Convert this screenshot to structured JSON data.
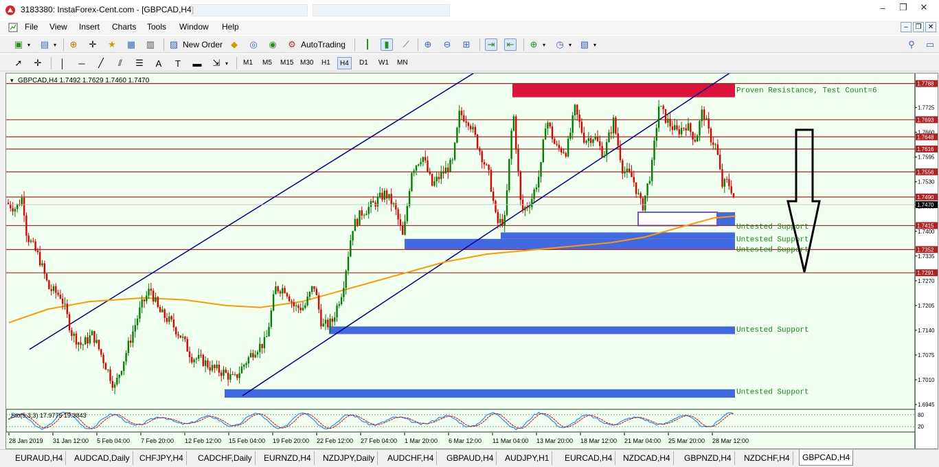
{
  "window": {
    "title": "3183380: InstaForex-Cent.com - [GBPCAD,H4]",
    "controls": [
      "–",
      "❐",
      "✕"
    ]
  },
  "menu": [
    "File",
    "View",
    "Insert",
    "Charts",
    "Tools",
    "Window",
    "Help"
  ],
  "toolbar": {
    "new_order": "New Order",
    "autotrading": "AutoTrading"
  },
  "timeframes": [
    "M1",
    "M5",
    "M15",
    "M30",
    "H1",
    "H4",
    "D1",
    "W1",
    "MN"
  ],
  "active_timeframe": "H4",
  "chart": {
    "header": "GBPCAD,H4  1.7492 1.7629 1.7460 1.7470",
    "current_price": "1.7470",
    "oscillator_label": "Sto(5,3,3) 17.9775 19.3843",
    "osc_levels": [
      "80",
      "20"
    ],
    "annotations": [
      {
        "text": "Proven Resistance, Test Count=6",
        "price": 1.777
      },
      {
        "text": "Untested Support",
        "price": 1.7412
      },
      {
        "text": "Untested Support",
        "price": 1.7379
      },
      {
        "text": "Untested Support",
        "price": 1.7352
      },
      {
        "text": "Untested Support",
        "price": 1.7142
      },
      {
        "text": "Untested Support",
        "price": 1.6978
      }
    ],
    "colors": {
      "bull": "#008000",
      "bear": "#e00000",
      "channel": "#00008b",
      "ma": "#ff9900",
      "resistance_zone": "#dc143c",
      "support_zone": "#4169e1",
      "hline": "#b22222",
      "annotation": "#1a8a1a",
      "stoch_main": "#1e90ff",
      "stoch_signal": "#e00000"
    }
  },
  "chart_data": {
    "type": "candlestick",
    "symbol": "GBPCAD",
    "timeframe": "H4",
    "y_ticks": [
      "1.7725",
      "1.7660",
      "1.7595",
      "1.7530",
      "1.7465",
      "1.7400",
      "1.7335",
      "1.7270",
      "1.7205",
      "1.7140",
      "1.7075",
      "1.7010",
      "1.6945"
    ],
    "ylim": [
      1.6936,
      1.78
    ],
    "price_labels": [
      {
        "text": "1.7788",
        "price": 1.7788
      },
      {
        "text": "1.7693",
        "price": 1.7693
      },
      {
        "text": "1.7648",
        "price": 1.7648
      },
      {
        "text": "1.7616",
        "price": 1.7616
      },
      {
        "text": "1.7556",
        "price": 1.7556
      },
      {
        "text": "1.7490",
        "price": 1.749
      },
      {
        "text": "1.7415",
        "price": 1.7415
      },
      {
        "text": "1.7352",
        "price": 1.7352
      },
      {
        "text": "1.7291",
        "price": 1.7291
      }
    ],
    "x_labels": [
      "28 Jan 2019",
      "31 Jan 12:00",
      "5 Feb 04:00",
      "7 Feb 20:00",
      "12 Feb 12:00",
      "15 Feb 04:00",
      "19 Feb 20:00",
      "22 Feb 12:00",
      "27 Feb 04:00",
      "1 Mar 20:00",
      "6 Mar 12:00",
      "11 Mar 04:00",
      "13 Mar 20:00",
      "18 Mar 12:00",
      "21 Mar 04:00",
      "25 Mar 20:00",
      "28 Mar 12:00"
    ],
    "close_path": [
      [
        0,
        1.7475
      ],
      [
        14,
        1.746
      ],
      [
        24,
        1.749
      ],
      [
        30,
        1.739
      ],
      [
        48,
        1.733
      ],
      [
        62,
        1.725
      ],
      [
        80,
        1.723
      ],
      [
        96,
        1.713
      ],
      [
        110,
        1.71
      ],
      [
        126,
        1.713
      ],
      [
        142,
        1.706
      ],
      [
        158,
        1.699
      ],
      [
        176,
        1.709
      ],
      [
        196,
        1.72
      ],
      [
        210,
        1.725
      ],
      [
        222,
        1.719
      ],
      [
        240,
        1.716
      ],
      [
        256,
        1.712
      ],
      [
        270,
        1.707
      ],
      [
        286,
        1.706
      ],
      [
        300,
        1.704
      ],
      [
        316,
        1.703
      ],
      [
        332,
        1.701
      ],
      [
        346,
        1.705
      ],
      [
        362,
        1.709
      ],
      [
        378,
        1.711
      ],
      [
        392,
        1.725
      ],
      [
        406,
        1.725
      ],
      [
        420,
        1.72
      ],
      [
        434,
        1.72
      ],
      [
        448,
        1.726
      ],
      [
        460,
        1.715
      ],
      [
        474,
        1.716
      ],
      [
        490,
        1.725
      ],
      [
        504,
        1.741
      ],
      [
        518,
        1.745
      ],
      [
        534,
        1.747
      ],
      [
        552,
        1.75
      ],
      [
        566,
        1.746
      ],
      [
        578,
        1.738
      ],
      [
        590,
        1.756
      ],
      [
        606,
        1.76
      ],
      [
        620,
        1.752
      ],
      [
        634,
        1.755
      ],
      [
        650,
        1.758
      ],
      [
        660,
        1.771
      ],
      [
        674,
        1.769
      ],
      [
        690,
        1.761
      ],
      [
        704,
        1.754
      ],
      [
        714,
        1.742
      ],
      [
        726,
        1.743
      ],
      [
        738,
        1.772
      ],
      [
        750,
        1.745
      ],
      [
        764,
        1.748
      ],
      [
        778,
        1.756
      ],
      [
        786,
        1.77
      ],
      [
        800,
        1.762
      ],
      [
        816,
        1.761
      ],
      [
        828,
        1.772
      ],
      [
        842,
        1.764
      ],
      [
        856,
        1.765
      ],
      [
        870,
        1.76
      ],
      [
        884,
        1.769
      ],
      [
        898,
        1.756
      ],
      [
        912,
        1.754
      ],
      [
        926,
        1.746
      ],
      [
        940,
        1.757
      ],
      [
        950,
        1.773
      ],
      [
        962,
        1.769
      ],
      [
        976,
        1.766
      ],
      [
        990,
        1.768
      ],
      [
        1004,
        1.764
      ],
      [
        1014,
        1.772
      ],
      [
        1024,
        1.765
      ],
      [
        1034,
        1.762
      ],
      [
        1042,
        1.752
      ],
      [
        1050,
        1.753
      ],
      [
        1056,
        1.751
      ],
      [
        1062,
        1.747
      ]
    ],
    "ma_path": [
      [
        4,
        1.716
      ],
      [
        60,
        1.7195
      ],
      [
        120,
        1.7215
      ],
      [
        200,
        1.7225
      ],
      [
        260,
        1.722
      ],
      [
        320,
        1.7205
      ],
      [
        370,
        1.72
      ],
      [
        430,
        1.7215
      ],
      [
        470,
        1.7235
      ],
      [
        520,
        1.726
      ],
      [
        580,
        1.729
      ],
      [
        640,
        1.732
      ],
      [
        700,
        1.734
      ],
      [
        760,
        1.735
      ],
      [
        820,
        1.736
      ],
      [
        880,
        1.737
      ],
      [
        930,
        1.7385
      ],
      [
        980,
        1.741
      ],
      [
        1030,
        1.7435
      ],
      [
        1062,
        1.744
      ]
    ],
    "hlines": [
      1.7788,
      1.7693,
      1.7648,
      1.7616,
      1.7556,
      1.749,
      1.7415,
      1.7352,
      1.7291
    ],
    "resistance_zone": {
      "x_start": 737,
      "x_end": 1061,
      "high": 1.7788,
      "low": 1.7752
    },
    "support_zones": [
      {
        "x_start": 920,
        "x_end": 1061,
        "high": 1.745,
        "low": 1.7415
      },
      {
        "x_start": 720,
        "x_end": 1061,
        "high": 1.7397,
        "low": 1.738
      },
      {
        "x_start": 580,
        "x_end": 1061,
        "high": 1.738,
        "low": 1.7353
      },
      {
        "x_start": 470,
        "x_end": 1061,
        "high": 1.715,
        "low": 1.713
      },
      {
        "x_start": 318,
        "x_end": 1061,
        "high": 1.6985,
        "low": 1.6963
      }
    ],
    "channel_lines": [
      {
        "x1": 34,
        "y1": 1.709,
        "x2": 765,
        "y2": 1.791
      },
      {
        "x1": 344,
        "y1": 1.6968,
        "x2": 1134,
        "y2": 1.7912
      }
    ]
  }
}
